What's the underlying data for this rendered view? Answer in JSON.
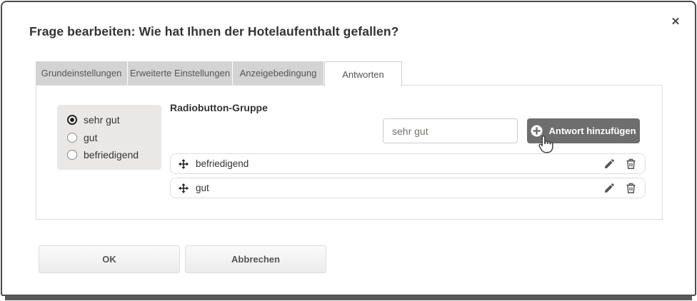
{
  "dialog": {
    "title": "Frage bearbeiten: Wie hat Ihnen der Hotelaufenthalt gefallen?",
    "close_glyph": "✕"
  },
  "tabs": [
    {
      "label": "Grundeinstellungen",
      "active": false
    },
    {
      "label": "Erweiterte Einstellungen",
      "active": false
    },
    {
      "label": "Anzeigebedingung",
      "active": false
    },
    {
      "label": "Antworten",
      "active": true
    }
  ],
  "preview": {
    "options": [
      {
        "label": "sehr gut",
        "selected": true
      },
      {
        "label": "gut",
        "selected": false
      },
      {
        "label": "befriedigend",
        "selected": false
      }
    ]
  },
  "editor": {
    "group_label": "Radiobutton-Gruppe",
    "answer_input_value": "sehr gut",
    "add_button_label": "Antwort hinzufügen",
    "answers": [
      {
        "label": "befriedigend"
      },
      {
        "label": "gut"
      }
    ]
  },
  "footer": {
    "ok_label": "OK",
    "cancel_label": "Abbrechen"
  },
  "colors": {
    "accent_button": "#6e6e6e",
    "tab_inactive_bg": "#d3d3d3",
    "panel_border": "#dddddd",
    "text_primary": "#333333",
    "modal_border": "#4b4b4b",
    "backdrop_bar": "#585858"
  }
}
